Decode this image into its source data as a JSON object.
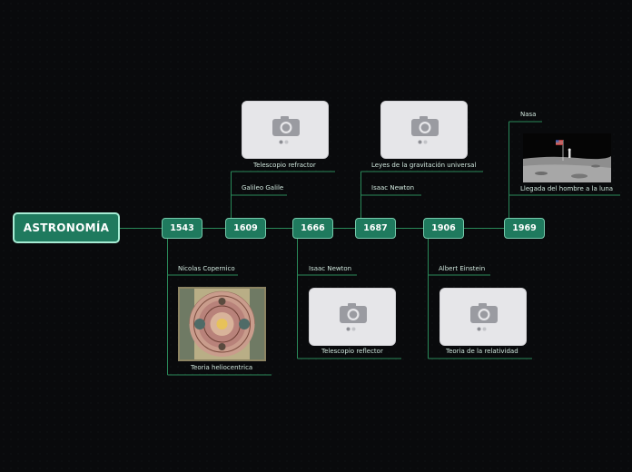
{
  "root": {
    "title": "ASTRONOMÍA"
  },
  "years": [
    "1543",
    "1609",
    "1666",
    "1687",
    "1906",
    "1969"
  ],
  "entries": {
    "y1543": {
      "person": "Nicolas Copernico",
      "topic": "Teoria heliocentrica"
    },
    "y1609": {
      "person": "Galileo Galile",
      "topic": "Telescopio refractor"
    },
    "y1666": {
      "person": "Isaac Newton",
      "topic": "Telescopio reflector"
    },
    "y1687": {
      "person": "Isaac Newton",
      "topic": "Leyes de la gravitación universal"
    },
    "y1906": {
      "person": "Albert Einstein",
      "topic": "Teoria de la relatividad"
    },
    "y1969": {
      "person": "Nasa",
      "topic": "Llegada del hombre a la luna"
    }
  },
  "colors": {
    "background": "#090a0c",
    "node_fill": "#1f7a5e",
    "node_border": "#a6ecd4",
    "connector": "#2a8a5a",
    "label_text": "#cfe6dc",
    "placeholder": "#e6e6e9"
  },
  "icons": [
    "camera-icon",
    "image-placeholder-dots-icon"
  ]
}
